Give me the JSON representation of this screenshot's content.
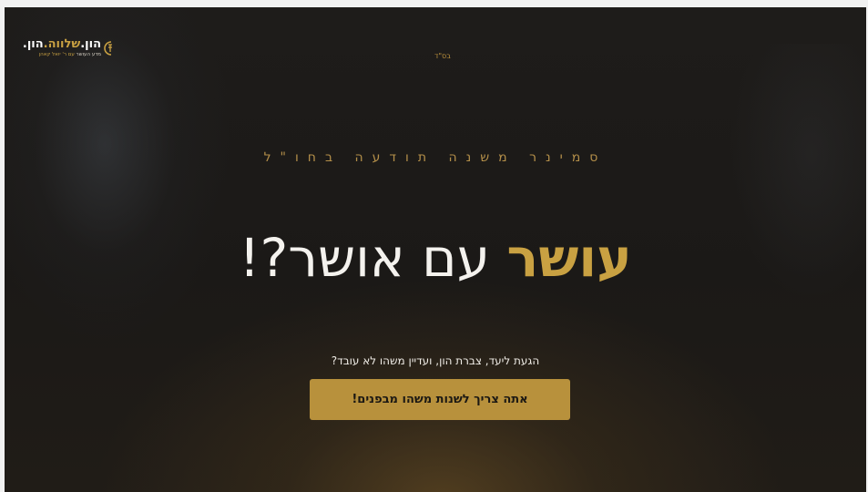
{
  "logo": {
    "title_part1": "הון.",
    "title_part2": "שלווה.",
    "title_part3": "הון.",
    "subtitle_part1": "מדע העושר",
    "subtitle_part2": " עם ר' יואל קאהן",
    "emblem_icon": "coin-emblem-icon"
  },
  "header": {
    "besd": "בס\"ד"
  },
  "hero": {
    "kicker": "סמינר משנה תודעה בחו\"ל",
    "headline_accent": "עושר",
    "headline_rest": " עם אושר?!",
    "subline": "הגעת ליעד, צברת הון, ועדיין משהו לא עובד?",
    "cta_label": "אתה צריך לשנות משהו מבפנים!"
  },
  "colors": {
    "accent": "#c9a142",
    "button": "#b8913c",
    "background": "#1e1c1a"
  }
}
